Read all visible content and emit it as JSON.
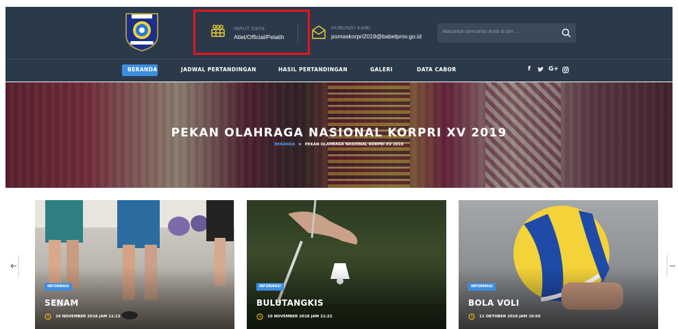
{
  "header": {
    "input_data": {
      "label": "INPUT DATA",
      "value": "Atlet/Official/Pelatih"
    },
    "contact": {
      "label": "HUBUNGI KAMI",
      "value": "pomaskorpri2019@babelprov.go.id"
    },
    "search": {
      "placeholder": "Masukkan pencarian Anda di sini ..."
    }
  },
  "nav": {
    "items": [
      "BERANDA",
      "JADWAL PERTANDINGAN",
      "HASIL PERTANDINGAN",
      "GALERI",
      "DATA CABOR"
    ],
    "active": "BERANDA",
    "social": [
      "f",
      "G+"
    ]
  },
  "hero": {
    "title": "PEKAN OLAHRAGA NASIONAL KORPRI XV 2019",
    "breadcrumb": {
      "home": "BERANDA",
      "separator": ">",
      "current": "PEKAN OLAHRAGA NASIONAL KORPRI XV 2019"
    }
  },
  "cards": [
    {
      "badge": "INFORMASI",
      "title": "SENAM",
      "date": "10 NOVEMBER 2018 JAM 11:13"
    },
    {
      "badge": "INFORMASI",
      "title": "BULUTANGKIS",
      "date": "10 NOVEMBER 2018 JAM 11:22"
    },
    {
      "badge": "INFORMASI",
      "title": "BOLA VOLI",
      "date": "11 OKTOBER 2018 JAM 10:50"
    }
  ],
  "colors": {
    "header_bg": "#2b3a4a",
    "accent": "#3d8ee0",
    "highlight_box": "#e8141b",
    "clock_icon": "#f2b51a"
  },
  "icons": [
    "logo-icon",
    "users-grid-icon",
    "envelope-icon",
    "search-icon",
    "twitter-icon",
    "instagram-icon",
    "clock-icon",
    "arrow-left-icon",
    "arrow-right-icon"
  ]
}
